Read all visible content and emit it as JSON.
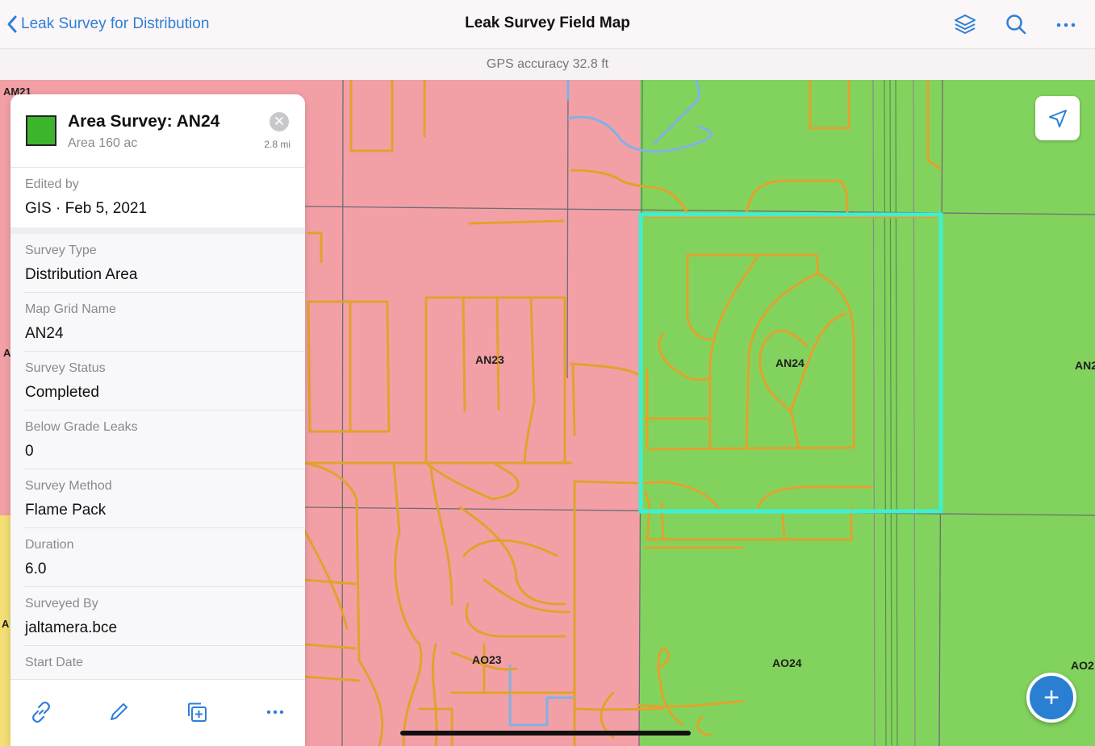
{
  "nav": {
    "back_label": "Leak Survey for Distribution",
    "title": "Leak Survey Field Map"
  },
  "gps": {
    "text": "GPS accuracy 32.8 ft"
  },
  "map": {
    "grid_labels": [
      "AM21",
      "AN23",
      "AN24",
      "AN2",
      "AO23",
      "AO24",
      "AO2",
      "A",
      "A"
    ],
    "colors": {
      "pink": "#f2a0a6",
      "green": "#82d35e",
      "roads": "#e2a22c",
      "highlight": "#3ff0d0",
      "water": "#7fb2e6"
    }
  },
  "panel": {
    "title": "Area Survey: AN24",
    "subtitle": "Area 160 ac",
    "distance": "2.8 mi",
    "edited": {
      "label": "Edited by",
      "value": "GIS · Feb 5, 2021"
    },
    "fields": [
      {
        "label": "Survey Type",
        "value": "Distribution Area"
      },
      {
        "label": "Map Grid Name",
        "value": "AN24"
      },
      {
        "label": "Survey Status",
        "value": "Completed"
      },
      {
        "label": "Below Grade Leaks",
        "value": "0"
      },
      {
        "label": "Survey Method",
        "value": "Flame Pack"
      },
      {
        "label": "Duration",
        "value": "6.0"
      },
      {
        "label": "Surveyed By",
        "value": "jaltamera.bce"
      },
      {
        "label": "Start Date",
        "value": ""
      }
    ],
    "footer_icons": [
      "link-icon",
      "pencil-icon",
      "duplicate-icon",
      "more-icon"
    ]
  },
  "add_button": {
    "label": "+"
  }
}
